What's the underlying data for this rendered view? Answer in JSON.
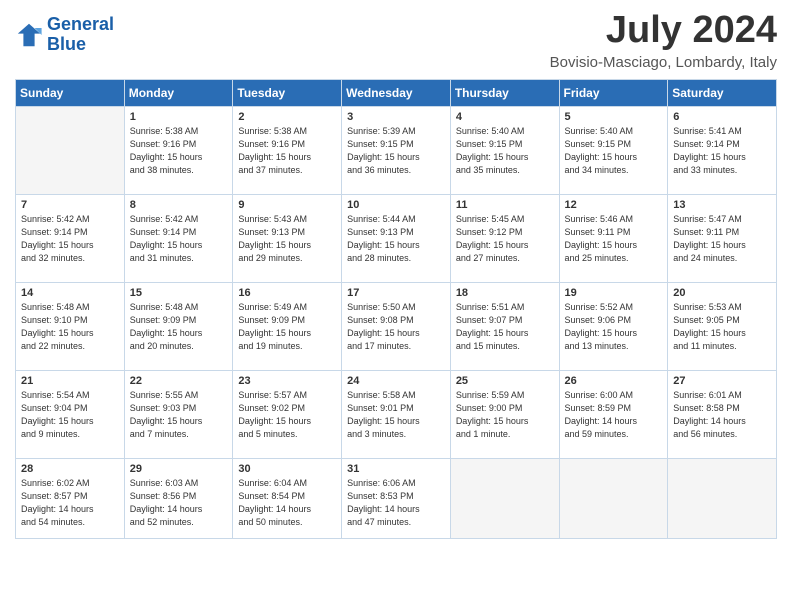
{
  "header": {
    "logo_line1": "General",
    "logo_line2": "Blue",
    "month_title": "July 2024",
    "location": "Bovisio-Masciago, Lombardy, Italy"
  },
  "days_of_week": [
    "Sunday",
    "Monday",
    "Tuesday",
    "Wednesday",
    "Thursday",
    "Friday",
    "Saturday"
  ],
  "weeks": [
    [
      {
        "num": "",
        "info": ""
      },
      {
        "num": "1",
        "info": "Sunrise: 5:38 AM\nSunset: 9:16 PM\nDaylight: 15 hours\nand 38 minutes."
      },
      {
        "num": "2",
        "info": "Sunrise: 5:38 AM\nSunset: 9:16 PM\nDaylight: 15 hours\nand 37 minutes."
      },
      {
        "num": "3",
        "info": "Sunrise: 5:39 AM\nSunset: 9:15 PM\nDaylight: 15 hours\nand 36 minutes."
      },
      {
        "num": "4",
        "info": "Sunrise: 5:40 AM\nSunset: 9:15 PM\nDaylight: 15 hours\nand 35 minutes."
      },
      {
        "num": "5",
        "info": "Sunrise: 5:40 AM\nSunset: 9:15 PM\nDaylight: 15 hours\nand 34 minutes."
      },
      {
        "num": "6",
        "info": "Sunrise: 5:41 AM\nSunset: 9:14 PM\nDaylight: 15 hours\nand 33 minutes."
      }
    ],
    [
      {
        "num": "7",
        "info": "Sunrise: 5:42 AM\nSunset: 9:14 PM\nDaylight: 15 hours\nand 32 minutes."
      },
      {
        "num": "8",
        "info": "Sunrise: 5:42 AM\nSunset: 9:14 PM\nDaylight: 15 hours\nand 31 minutes."
      },
      {
        "num": "9",
        "info": "Sunrise: 5:43 AM\nSunset: 9:13 PM\nDaylight: 15 hours\nand 29 minutes."
      },
      {
        "num": "10",
        "info": "Sunrise: 5:44 AM\nSunset: 9:13 PM\nDaylight: 15 hours\nand 28 minutes."
      },
      {
        "num": "11",
        "info": "Sunrise: 5:45 AM\nSunset: 9:12 PM\nDaylight: 15 hours\nand 27 minutes."
      },
      {
        "num": "12",
        "info": "Sunrise: 5:46 AM\nSunset: 9:11 PM\nDaylight: 15 hours\nand 25 minutes."
      },
      {
        "num": "13",
        "info": "Sunrise: 5:47 AM\nSunset: 9:11 PM\nDaylight: 15 hours\nand 24 minutes."
      }
    ],
    [
      {
        "num": "14",
        "info": "Sunrise: 5:48 AM\nSunset: 9:10 PM\nDaylight: 15 hours\nand 22 minutes."
      },
      {
        "num": "15",
        "info": "Sunrise: 5:48 AM\nSunset: 9:09 PM\nDaylight: 15 hours\nand 20 minutes."
      },
      {
        "num": "16",
        "info": "Sunrise: 5:49 AM\nSunset: 9:09 PM\nDaylight: 15 hours\nand 19 minutes."
      },
      {
        "num": "17",
        "info": "Sunrise: 5:50 AM\nSunset: 9:08 PM\nDaylight: 15 hours\nand 17 minutes."
      },
      {
        "num": "18",
        "info": "Sunrise: 5:51 AM\nSunset: 9:07 PM\nDaylight: 15 hours\nand 15 minutes."
      },
      {
        "num": "19",
        "info": "Sunrise: 5:52 AM\nSunset: 9:06 PM\nDaylight: 15 hours\nand 13 minutes."
      },
      {
        "num": "20",
        "info": "Sunrise: 5:53 AM\nSunset: 9:05 PM\nDaylight: 15 hours\nand 11 minutes."
      }
    ],
    [
      {
        "num": "21",
        "info": "Sunrise: 5:54 AM\nSunset: 9:04 PM\nDaylight: 15 hours\nand 9 minutes."
      },
      {
        "num": "22",
        "info": "Sunrise: 5:55 AM\nSunset: 9:03 PM\nDaylight: 15 hours\nand 7 minutes."
      },
      {
        "num": "23",
        "info": "Sunrise: 5:57 AM\nSunset: 9:02 PM\nDaylight: 15 hours\nand 5 minutes."
      },
      {
        "num": "24",
        "info": "Sunrise: 5:58 AM\nSunset: 9:01 PM\nDaylight: 15 hours\nand 3 minutes."
      },
      {
        "num": "25",
        "info": "Sunrise: 5:59 AM\nSunset: 9:00 PM\nDaylight: 15 hours\nand 1 minute."
      },
      {
        "num": "26",
        "info": "Sunrise: 6:00 AM\nSunset: 8:59 PM\nDaylight: 14 hours\nand 59 minutes."
      },
      {
        "num": "27",
        "info": "Sunrise: 6:01 AM\nSunset: 8:58 PM\nDaylight: 14 hours\nand 56 minutes."
      }
    ],
    [
      {
        "num": "28",
        "info": "Sunrise: 6:02 AM\nSunset: 8:57 PM\nDaylight: 14 hours\nand 54 minutes."
      },
      {
        "num": "29",
        "info": "Sunrise: 6:03 AM\nSunset: 8:56 PM\nDaylight: 14 hours\nand 52 minutes."
      },
      {
        "num": "30",
        "info": "Sunrise: 6:04 AM\nSunset: 8:54 PM\nDaylight: 14 hours\nand 50 minutes."
      },
      {
        "num": "31",
        "info": "Sunrise: 6:06 AM\nSunset: 8:53 PM\nDaylight: 14 hours\nand 47 minutes."
      },
      {
        "num": "",
        "info": ""
      },
      {
        "num": "",
        "info": ""
      },
      {
        "num": "",
        "info": ""
      }
    ]
  ]
}
